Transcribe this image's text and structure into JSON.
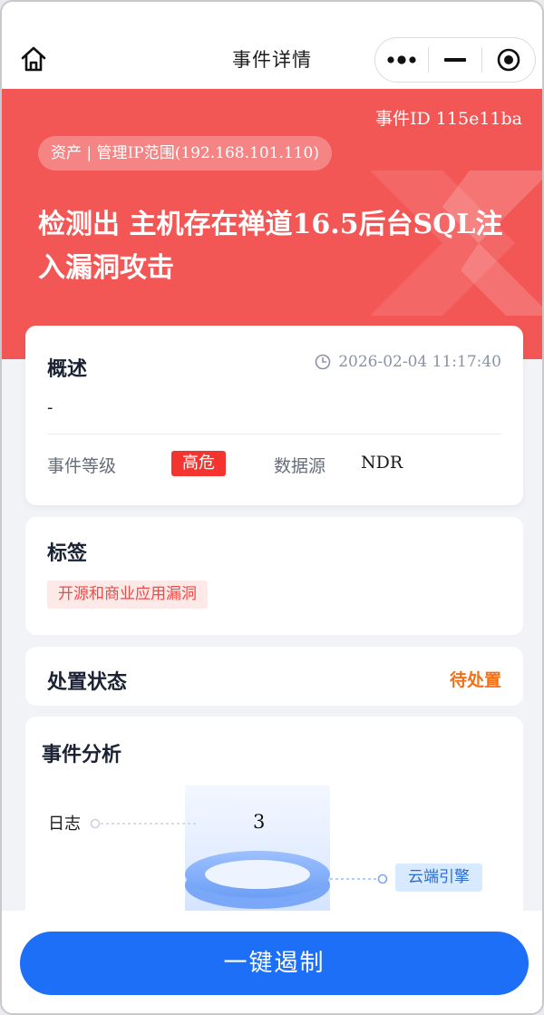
{
  "nav": {
    "title": "事件详情",
    "icons": [
      "home-icon",
      "more-dots-icon",
      "minimize-icon",
      "target-close-icon"
    ]
  },
  "hero": {
    "event_id": "事件ID 115e11ba",
    "asset_pill": "资产 | 管理IP范围(192.168.101.110)",
    "title": "检测出 主机存在禅道16.5后台SQL注入漏洞攻击",
    "bg_color": "#f25756"
  },
  "overview": {
    "heading": "概述",
    "time": "2026-02-04 11:17:40",
    "description": "-",
    "level_label": "事件等级",
    "level_value": "高危",
    "source_label": "数据源",
    "source_value": "NDR",
    "level_color": "#f3342f"
  },
  "tags": {
    "heading": "标签",
    "items": [
      "开源和商业应用漏洞"
    ]
  },
  "status": {
    "heading": "处置状态",
    "value": "待处置",
    "value_color": "#f27018"
  },
  "analysis": {
    "heading": "事件分析",
    "log_label": "日志",
    "log_count": "3",
    "engine_label": "云端引擎"
  },
  "actions": {
    "primary_label": "一键遏制",
    "primary_color": "#1d6ff8"
  }
}
